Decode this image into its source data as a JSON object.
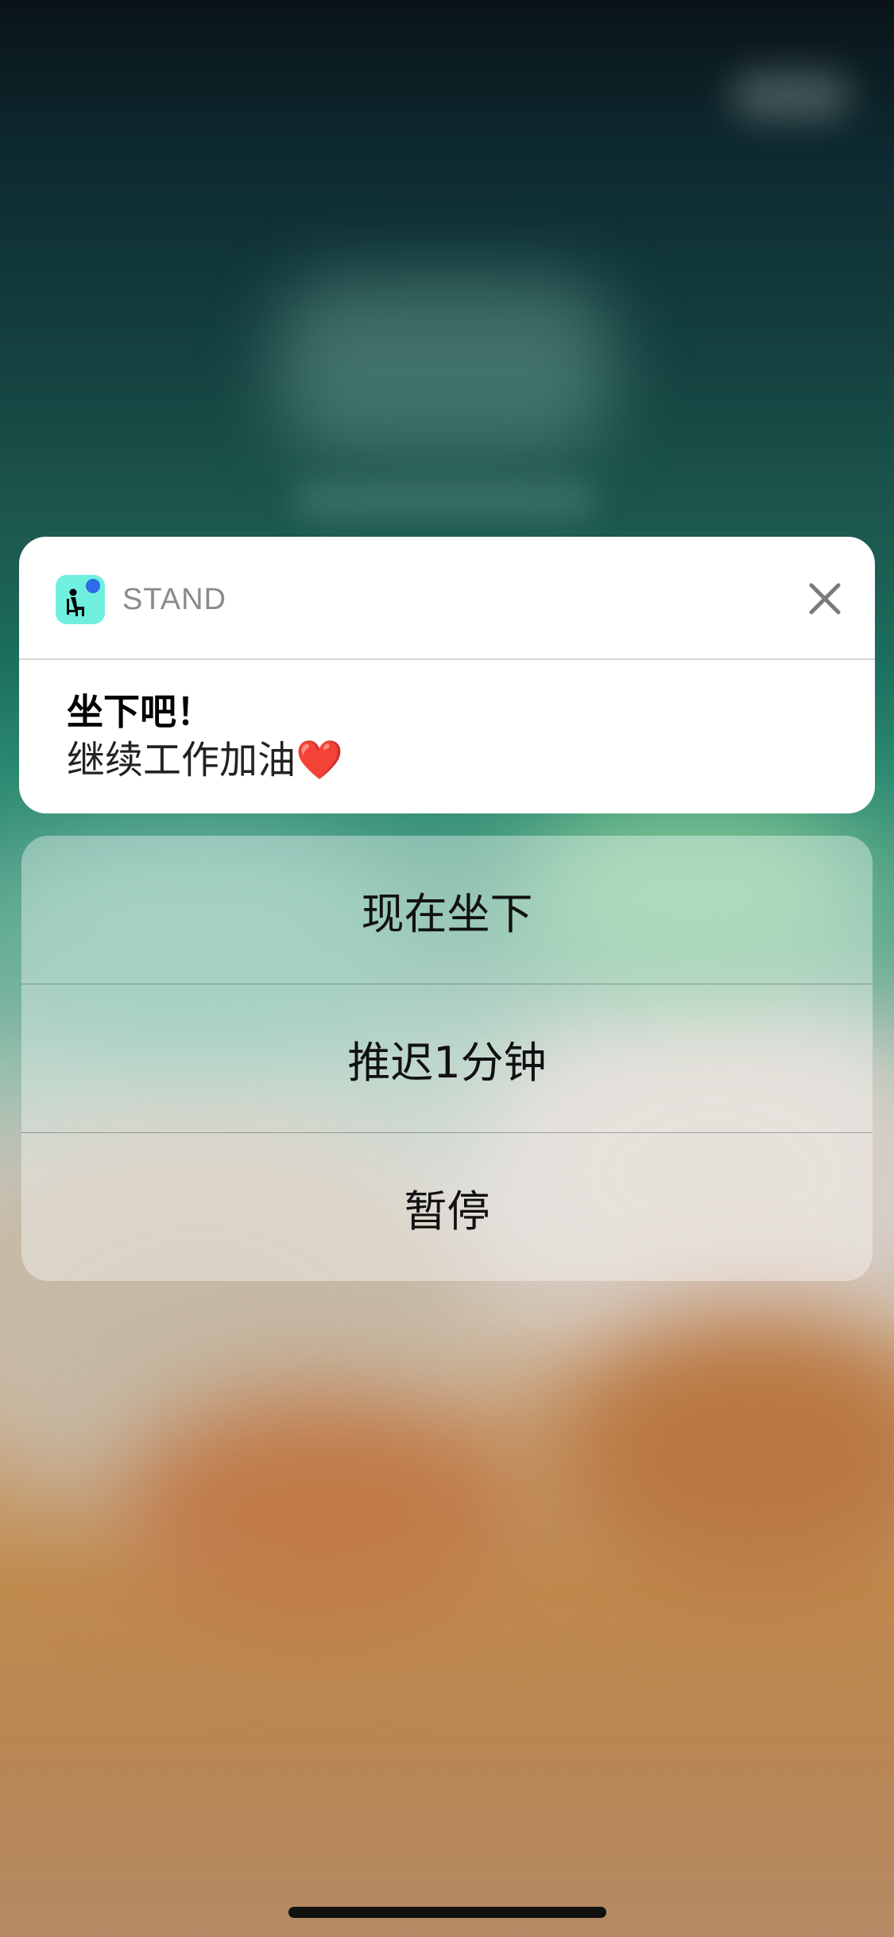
{
  "notification": {
    "app_icon": "sitting-person-icon",
    "app_name": "STAND",
    "close_icon": "close-icon",
    "title": "坐下吧！",
    "message": "继续工作加油",
    "message_emoji": "❤️"
  },
  "actions": [
    {
      "label": "现在坐下"
    },
    {
      "label": "推迟1分钟"
    },
    {
      "label": "暂停"
    }
  ],
  "colors": {
    "card_background": "#ffffff",
    "app_name_color": "#8a8a8e",
    "app_icon_background": "#6ff0df",
    "heart": "#d0021b"
  }
}
